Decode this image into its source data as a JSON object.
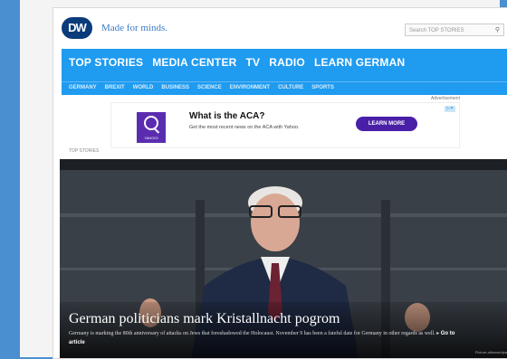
{
  "header": {
    "logo_text": "DW",
    "tagline": "Made for minds.",
    "search_placeholder": "Search TOP STORIES"
  },
  "nav": {
    "primary": [
      "TOP STORIES",
      "MEDIA CENTER",
      "TV",
      "RADIO",
      "LEARN GERMAN"
    ],
    "secondary": [
      "GERMANY",
      "BREXIT",
      "WORLD",
      "BUSINESS",
      "SCIENCE",
      "ENVIRONMENT",
      "CULTURE",
      "SPORTS"
    ]
  },
  "ad": {
    "label": "Advertisement",
    "brand": "YAHOO!",
    "title": "What is the ACA?",
    "description": "Get the most recent news on the ACA with Yahoo.",
    "cta": "LEARN MORE"
  },
  "section_label": "TOP STORIES",
  "hero": {
    "headline": "German politicians mark Kristallnacht pogrom",
    "summary": "Germany is marking the 80th anniversary of attacks on Jews that foreshadowed the Holocaust. November 9 has been a fateful date for Germany in other regards as well.",
    "link": "Go to article",
    "credit": "Picture-alliance/dpa"
  },
  "colors": {
    "nav_blue": "#1f9bf0",
    "logo_navy": "#0a3b7a",
    "ad_purple": "#4a1fa8"
  }
}
